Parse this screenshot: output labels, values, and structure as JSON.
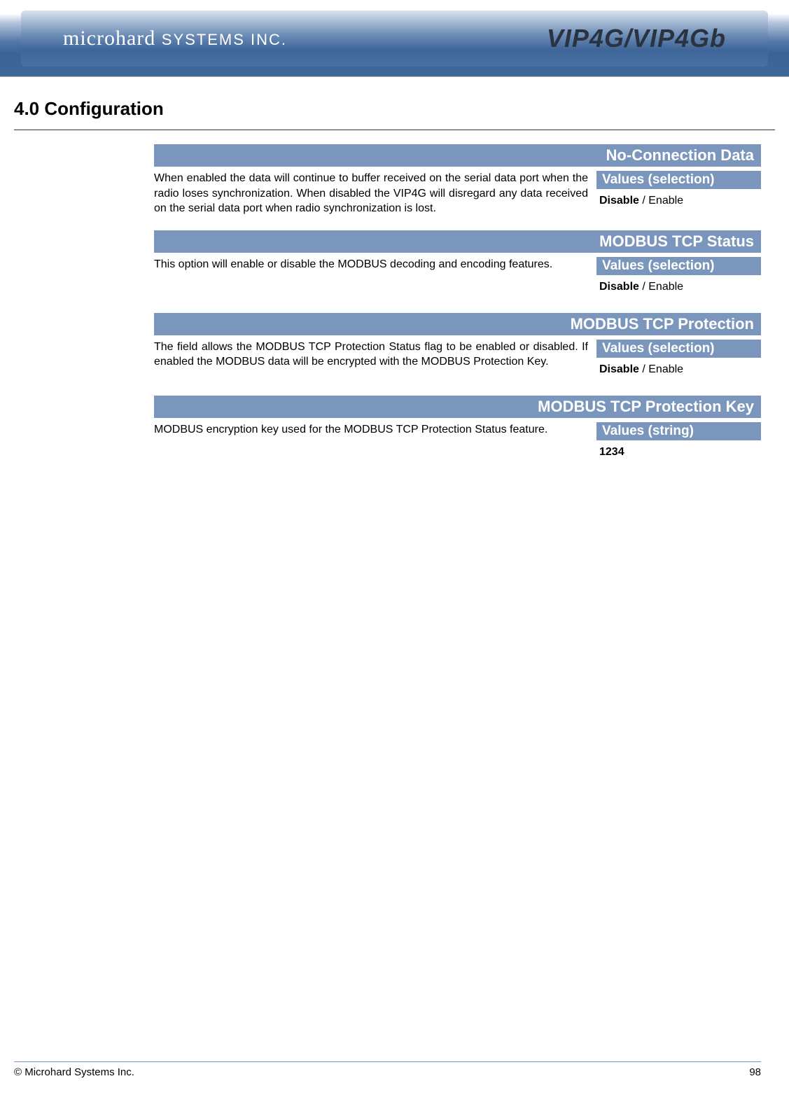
{
  "header": {
    "company_logo": "microhard",
    "company_suffix": "SYSTEMS INC.",
    "product_logo": "VIP4G/VIP4Gb"
  },
  "page_title": "4.0  Configuration",
  "sections": [
    {
      "title": "No-Connection Data",
      "description": "When enabled the data will continue to buffer received on the serial data port when the radio loses synchronization. When disabled the VIP4G will disregard any data received on the serial data port when radio synchronization is lost.",
      "values_label": "Values (selection)",
      "value_bold": "Disable",
      "value_rest": "  / Enable"
    },
    {
      "title": "MODBUS TCP Status",
      "description": "This option will enable or disable the MODBUS decoding and encoding features.",
      "values_label": "Values (selection)",
      "value_bold": "Disable",
      "value_rest": "  / Enable"
    },
    {
      "title": "MODBUS TCP Protection",
      "description": "The field allows the MODBUS TCP Protection Status flag to be enabled or disabled. If enabled the MODBUS data will be encrypted with the MODBUS Protection Key.",
      "values_label": "Values (selection)",
      "value_bold": "Disable",
      "value_rest": "  / Enable"
    },
    {
      "title": "MODBUS TCP Protection Key",
      "description": "MODBUS encryption key used for the MODBUS TCP Protection Status feature.",
      "values_label": "Values (string)",
      "value_bold": "1234",
      "value_rest": ""
    }
  ],
  "footer": {
    "copyright": "© Microhard Systems Inc.",
    "page_number": "98"
  }
}
